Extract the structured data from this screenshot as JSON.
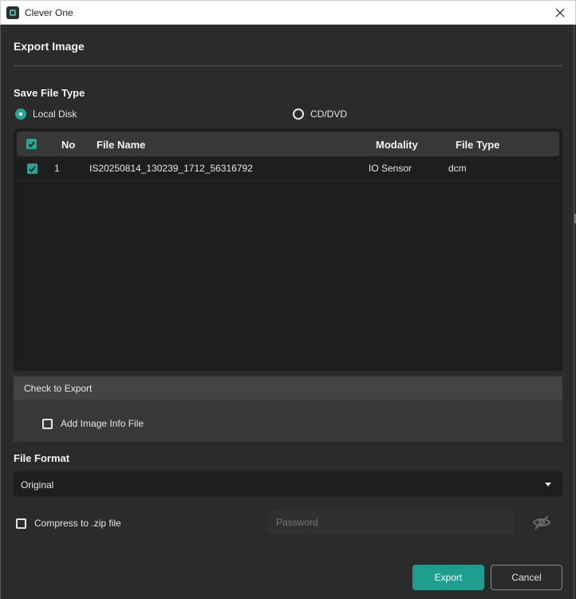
{
  "window": {
    "title": "Clever One"
  },
  "dialog": {
    "title": "Export Image"
  },
  "save_file_type": {
    "label": "Save File Type",
    "options": [
      {
        "label": "Local Disk",
        "selected": true
      },
      {
        "label": "CD/DVD",
        "selected": false
      }
    ]
  },
  "table": {
    "columns": [
      "No",
      "File Name",
      "Modality",
      "File Type"
    ],
    "rows": [
      {
        "checked": true,
        "no": "1",
        "file_name": "IS20250814_130239_1712_56316792",
        "modality": "IO Sensor",
        "file_type": "dcm"
      }
    ]
  },
  "check_to_export": {
    "header": "Check to Export",
    "add_image_info_label": "Add Image Info File",
    "add_image_info_checked": false
  },
  "file_format": {
    "label": "File Format",
    "selected": "Original"
  },
  "compress": {
    "label": "Compress to .zip file",
    "checked": false,
    "password_placeholder": "Password"
  },
  "buttons": {
    "export": "Export",
    "cancel": "Cancel"
  },
  "colors": {
    "accent": "#26a69a",
    "background": "#2b2b2b",
    "panel": "#1e1e1e"
  },
  "icons": {
    "app": "app-logo-icon",
    "close": "close-icon",
    "password_visibility": "eye-off-icon",
    "dropdown": "caret-down-icon"
  }
}
